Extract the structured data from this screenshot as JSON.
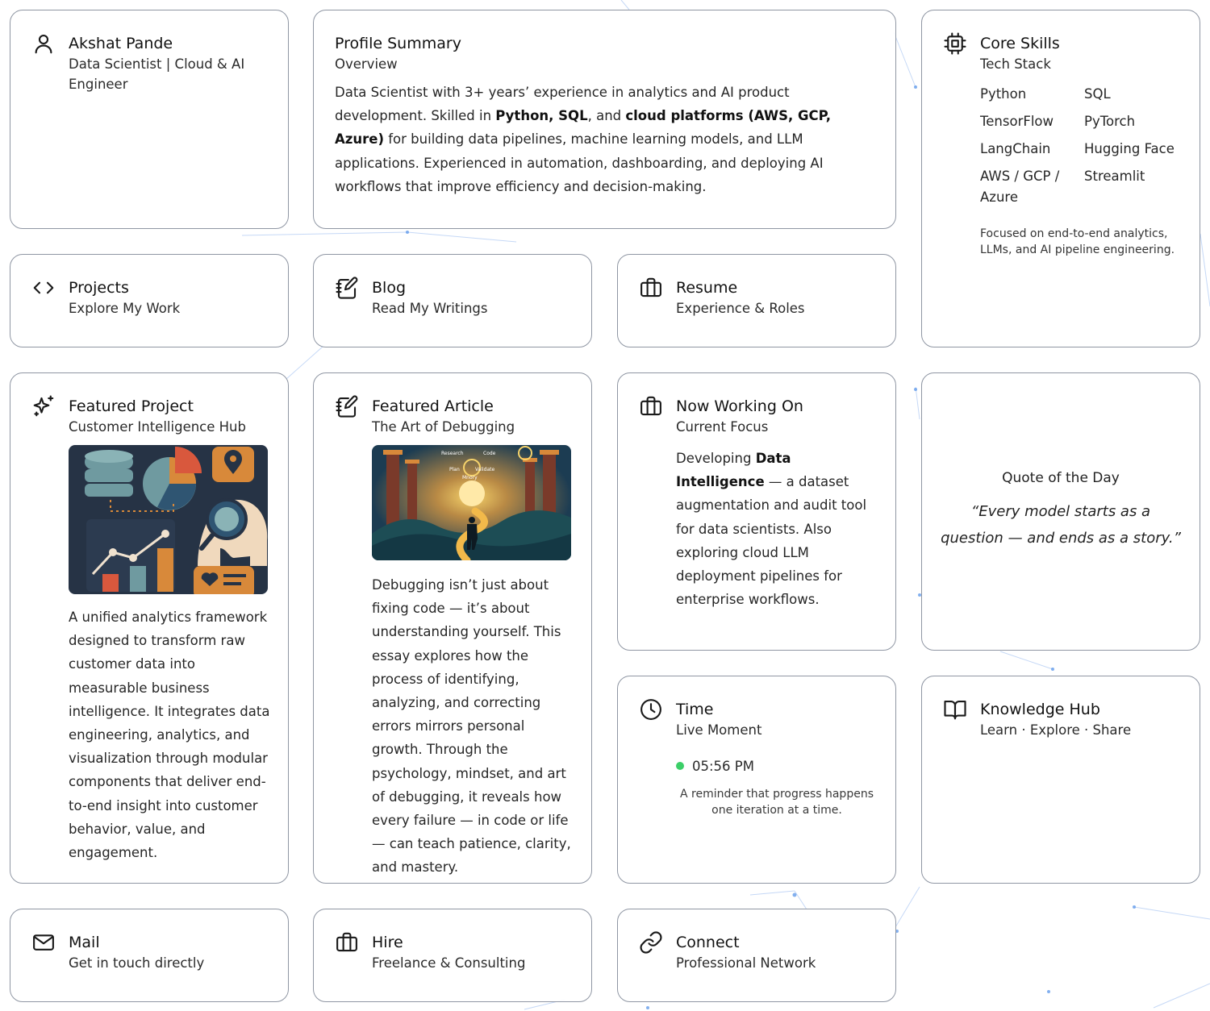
{
  "profile": {
    "name": "Akshat Pande",
    "role": "Data Scientist | Cloud & AI Engineer",
    "icon": "user-icon"
  },
  "summary": {
    "title": "Profile Summary",
    "subtitle": "Overview",
    "text_1": "Data Scientist with 3+ years’ experience in analytics and AI product development. Skilled in ",
    "bold_1": "Python, SQL",
    "text_2": ", and ",
    "bold_2": "cloud platforms (AWS, GCP, Azure)",
    "text_3": " for building data pipelines, machine learning models, and LLM applications. Experienced in automation, dashboarding, and deploying AI workflows that improve efficiency and decision-making."
  },
  "skills": {
    "title": "Core Skills",
    "subtitle": "Tech Stack",
    "items": [
      "Python",
      "SQL",
      "TensorFlow",
      "PyTorch",
      "LangChain",
      "Hugging Face",
      "AWS / GCP / Azure",
      "Streamlit"
    ],
    "note": "Focused on end-to-end analytics, LLMs, and AI pipeline engineering.",
    "icon": "chip-icon"
  },
  "nav": {
    "projects": {
      "title": "Projects",
      "subtitle": "Explore My Work",
      "icon": "code-icon"
    },
    "blog": {
      "title": "Blog",
      "subtitle": "Read My Writings",
      "icon": "notebook-pen-icon"
    },
    "resume": {
      "title": "Resume",
      "subtitle": "Experience & Roles",
      "icon": "briefcase-icon"
    }
  },
  "featured_project": {
    "title": "Featured Project",
    "subtitle": "Customer Intelligence Hub",
    "description": "A unified analytics framework designed to transform raw customer data into measurable business intelligence. It integrates data engineering, analytics, and visualization through modular components that deliver end-to-end insight into customer behavior, value, and engagement.",
    "icon": "sparkles-icon"
  },
  "featured_article": {
    "title": "Featured Article",
    "subtitle": "The Art of Debugging",
    "image_labels": [
      "Research",
      "Code",
      "Plan",
      "Validate",
      "Mnory"
    ],
    "description": "Debugging isn’t just about fixing code — it’s about understanding yourself. This essay explores how the process of identifying, analyzing, and correcting errors mirrors personal growth. Through the psychology, mindset, and art of debugging, it reveals how every failure — in code or life — can teach patience, clarity, and mastery.",
    "icon": "notebook-pen-icon"
  },
  "now_working": {
    "title": "Now Working On",
    "subtitle": "Current Focus",
    "text_1": "Developing ",
    "bold_1": "Data Intelligence",
    "text_2": " — a dataset augmentation and audit tool for data scientists. Also exploring cloud LLM deployment pipelines for enterprise workflows.",
    "icon": "briefcase-icon"
  },
  "quote": {
    "title": "Quote of the Day",
    "text": "“Every model starts as a question — and ends as a story.”"
  },
  "time": {
    "title": "Time",
    "subtitle": "Live Moment",
    "clock": "05:56 PM",
    "note": "A reminder that progress happens one iteration at a time.",
    "status_color": "#3ccf68",
    "icon": "clock-icon"
  },
  "knowledge": {
    "title": "Knowledge Hub",
    "subtitle": "Learn · Explore · Share",
    "icon": "book-open-icon"
  },
  "contact": {
    "mail": {
      "title": "Mail",
      "subtitle": "Get in touch directly",
      "icon": "mail-icon"
    },
    "hire": {
      "title": "Hire",
      "subtitle": "Freelance & Consulting",
      "icon": "briefcase-icon"
    },
    "connect": {
      "title": "Connect",
      "subtitle": "Professional Network",
      "icon": "link-icon"
    }
  },
  "colors": {
    "border": "#8f96a3",
    "network_accent": "#4f8ee8",
    "text": "#1a1a1a"
  }
}
